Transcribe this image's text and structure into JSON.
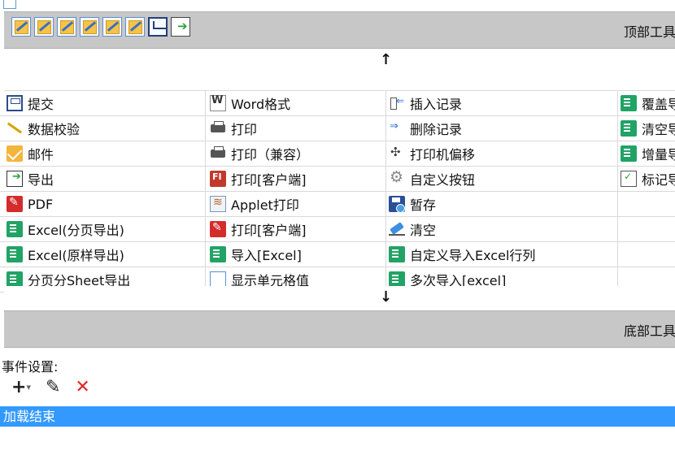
{
  "top_toolbar": {
    "title": "顶部工具",
    "icons": [
      "edit-icon",
      "edit-icon",
      "edit-icon",
      "edit-icon",
      "edit-icon",
      "edit-icon",
      "save-icon",
      "export-icon"
    ]
  },
  "arrows": {
    "up": "↑",
    "down": "↓"
  },
  "grid": [
    [
      "提交",
      "Word格式",
      "插入记录",
      "覆盖导"
    ],
    [
      "数据校验",
      "打印",
      "删除记录",
      "清空导"
    ],
    [
      "邮件",
      "打印（兼容）",
      "打印机偏移",
      "增量导"
    ],
    [
      "导出",
      "打印[客户端]",
      "自定义按钮",
      "标记导"
    ],
    [
      "PDF",
      "Applet打印",
      "暂存",
      ""
    ],
    [
      "Excel(分页导出)",
      "打印[客户端]",
      "清空",
      ""
    ],
    [
      "Excel(原样导出)",
      "导入[Excel]",
      "自定义导入Excel行列",
      ""
    ],
    [
      "分页分Sheet导出",
      "显示单元格值",
      "多次导入[excel]",
      ""
    ]
  ],
  "bottom_toolbar": {
    "title": "底部工具"
  },
  "events": {
    "label": "事件设置:",
    "add_symbol": "+",
    "add_caret": "▾",
    "edit_symbol": "✎",
    "delete_symbol": "✕",
    "items": [
      "加载结束"
    ]
  }
}
